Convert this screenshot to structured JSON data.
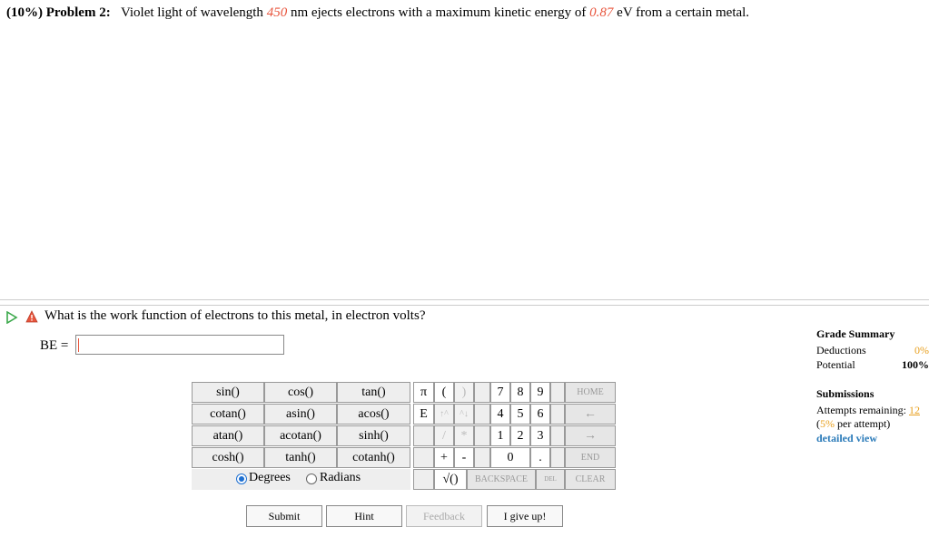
{
  "problem": {
    "prefix": "(10%) Problem 2:",
    "text1": "Violet light of wavelength ",
    "wavelength": "450",
    "text2": " nm ejects electrons with a maximum kinetic energy of ",
    "energy": "0.87",
    "text3": " eV from a certain metal."
  },
  "question": {
    "text": "What is the work function of electrons to this metal, in electron volts?",
    "answer_label": "BE =",
    "answer_value": ""
  },
  "functions": {
    "row1": [
      "sin()",
      "cos()",
      "tan()"
    ],
    "row2": [
      "cotan()",
      "asin()",
      "acos()"
    ],
    "row3": [
      "atan()",
      "acotan()",
      "sinh()"
    ],
    "row4": [
      "cosh()",
      "tanh()",
      "cotanh()"
    ],
    "degrees": "Degrees",
    "radians": "Radians",
    "selected": "Degrees"
  },
  "keypad": {
    "pi": "π",
    "open_paren": "(",
    "close_paren": ")",
    "e": "E",
    "up_arrow": "↑^",
    "down_arrow": "^↓",
    "divide": "/",
    "multiply": "*",
    "plus": "+",
    "minus": "-",
    "sqrt": "√()",
    "digits_row1": [
      "7",
      "8",
      "9"
    ],
    "digits_row2": [
      "4",
      "5",
      "6"
    ],
    "digits_row3": [
      "1",
      "2",
      "3"
    ],
    "zero": "0",
    "dot": ".",
    "home": "HOME",
    "left": "←",
    "right": "→",
    "end": "END",
    "backspace": "BACKSPACE",
    "del": "DEL",
    "clear": "CLEAR"
  },
  "actions": {
    "submit": "Submit",
    "hint": "Hint",
    "feedback": "Feedback",
    "give_up": "I give up!"
  },
  "grade_summary": {
    "title": "Grade Summary",
    "deductions_label": "Deductions",
    "deductions_value": "0%",
    "potential_label": "Potential",
    "potential_value": "100%"
  },
  "submissions": {
    "title": "Submissions",
    "attempts_label": "Attempts remaining:",
    "attempts_value": "12",
    "per_attempt_open": "(",
    "per_attempt_pct": "5%",
    "per_attempt_rest": " per attempt)",
    "detailed_view": "detailed view"
  }
}
